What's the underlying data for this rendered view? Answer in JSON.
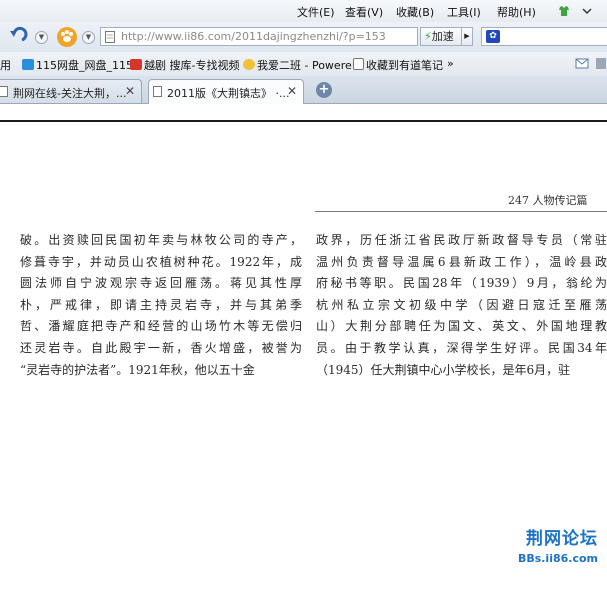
{
  "menubar": {
    "items": [
      "文件(E)",
      "查看(V)",
      "收藏(B)",
      "工具(I)",
      "帮助(H)"
    ]
  },
  "address": {
    "url": "http://www.ii86.com/2011dajingzhenzhi/?p=153",
    "go_label": "加速"
  },
  "bookmarks": {
    "items": [
      "用",
      "115网盘_网盘_115",
      "越剧 搜库-专找视频",
      "我爱二班 - Powere",
      "收藏到有道笔记",
      "»"
    ]
  },
  "tabs": [
    {
      "label": "荆网在线-关注大荆，...",
      "active": false
    },
    {
      "label": "2011版《大荆镇志》 ·...",
      "active": true
    }
  ],
  "page": {
    "header": "247  人物传记篇",
    "left_column": [
      "破。出资赎回民国初年卖与林牧公司的寺产，",
      "修葺寺宇，并动员山农植树种花。1922年，成",
      "圆法师自宁波观宗寺返回雁荡。蒋见其性厚",
      "朴，严戒律，即请主持灵岩寺，并与其弟季",
      "哲、潘耀庭把寺产和经营的山场竹木等无偿归",
      "还灵岩寺。自此殿宇一新，香火增盛，被誉为",
      "“灵岩寺的护法者”。1921年秋，他以五十金"
    ],
    "right_column": [
      "政界，历任浙江省民政厅新政督导专员（常驻",
      "温州负责督导温属6县新政工作），温岭县政",
      "府秘书等职。民国28年（1939）9月，翁纶为",
      "杭州私立宗文初级中学（因避日寇迁至雁荡",
      "山）大荆分部聘任为国文、英文、外国地理教",
      "员。由于教学认真，深得学生好评。民国34年",
      "（1945）任大荆镇中心小学校长，是年6月，驻"
    ]
  },
  "watermark": {
    "title": "荆网论坛",
    "url": "BBs.ii86.com"
  },
  "colors": {
    "accent": "#1b73c9",
    "chrome": "#dfe6ee"
  }
}
